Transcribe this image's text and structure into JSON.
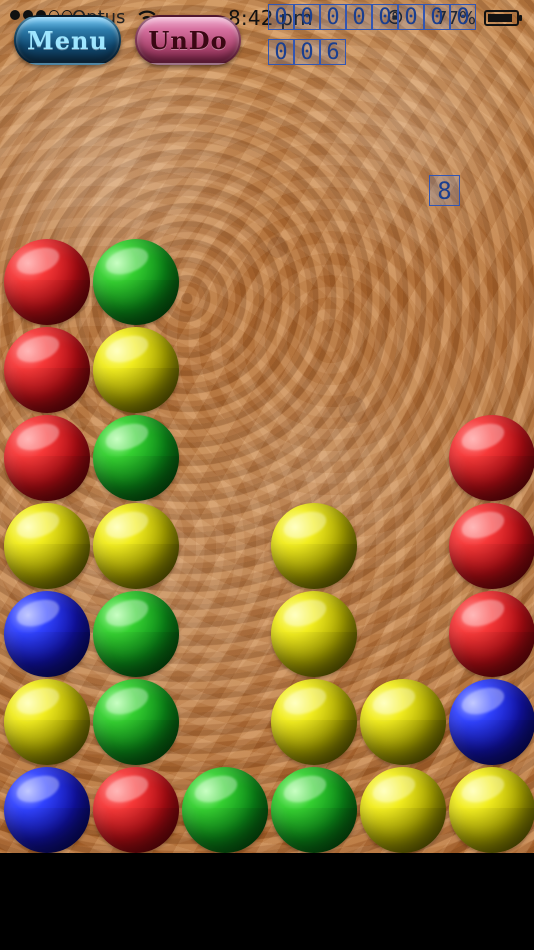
{
  "status_bar": {
    "carrier": "Optus",
    "time": "8:42 pm",
    "battery_percent": "77%",
    "signal_dots_filled": 3,
    "signal_dots_total": 5,
    "wifi_icon": "wifi-icon",
    "rotation_lock_icon": "rotation-lock-icon",
    "battery_icon": "battery-icon"
  },
  "controls": {
    "menu_label": "Menu",
    "undo_label": "UnDo"
  },
  "counters": {
    "top_digits": [
      "0",
      "0",
      "0",
      "0",
      "0",
      "0",
      "0",
      "0"
    ],
    "second_digits": [
      "0",
      "0",
      "6"
    ],
    "right_indicator": "8"
  },
  "board": {
    "columns": 6,
    "rows": 7,
    "cells": [
      [
        null,
        null,
        null,
        null,
        null,
        null
      ],
      [
        "red",
        "green",
        null,
        null,
        null,
        null
      ],
      [
        "red",
        "yellow",
        null,
        null,
        null,
        null
      ],
      [
        "red",
        "green",
        null,
        null,
        null,
        "red"
      ],
      [
        "yellow",
        "yellow",
        null,
        "yellow",
        null,
        "red"
      ],
      [
        "blue",
        "green",
        null,
        "yellow",
        null,
        "red"
      ],
      [
        "yellow",
        "green",
        null,
        "yellow",
        "yellow",
        "blue"
      ],
      [
        "blue",
        "red",
        "green",
        "green",
        "yellow",
        "yellow"
      ]
    ]
  }
}
